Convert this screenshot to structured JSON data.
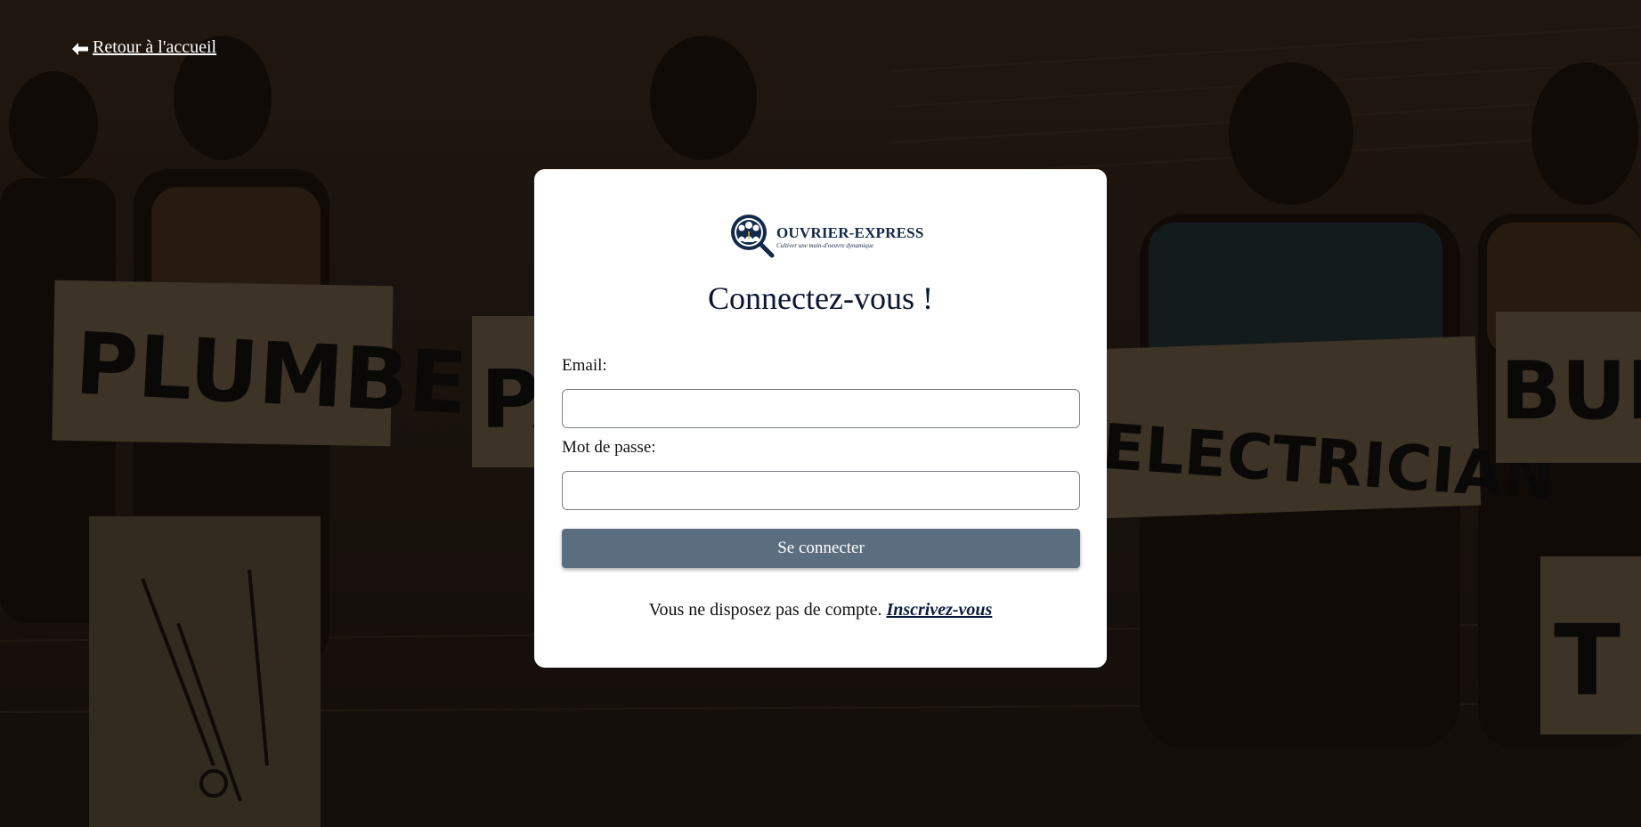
{
  "nav": {
    "back_label": " Retour à l'accueil"
  },
  "background": {
    "signs": [
      "PLUMBER",
      "ELECTRICIAN",
      "BUIL",
      "PA",
      "T"
    ]
  },
  "logo": {
    "name": "OUVRIER-EXPRESS",
    "tagline": "Cultiver une main-d'oeuvre dynamique"
  },
  "login": {
    "title": "Connectez-vous !",
    "email_label": "Email:",
    "email_value": "",
    "password_label": "Mot de passe:",
    "password_value": "",
    "submit_label": "Se connecter",
    "signup_prompt": "Vous ne disposez pas de compte. ",
    "signup_link": "Inscrivez-vous"
  },
  "colors": {
    "button_bg": "#5b6e80",
    "title": "#0b1433",
    "logo": "#12294a"
  }
}
